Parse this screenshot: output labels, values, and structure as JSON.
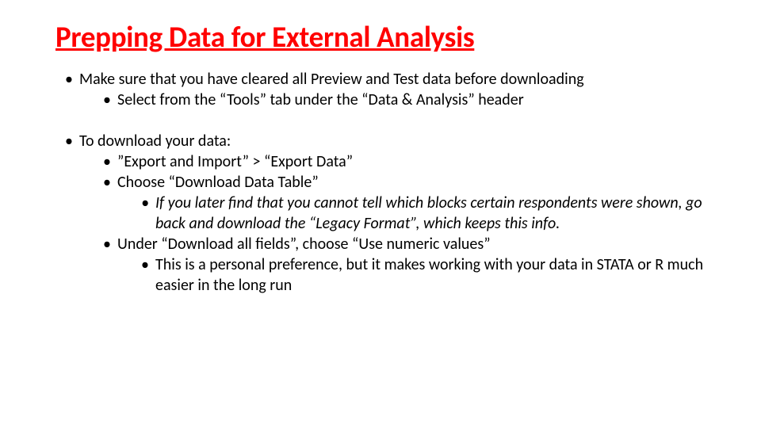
{
  "title": "Prepping Data for External Analysis",
  "bullets": {
    "a1": "Make sure that you have cleared all Preview and Test data before downloading",
    "a1_1": "Select from the “Tools” tab under the “Data & Analysis” header",
    "b1": "To download your data:",
    "b1_1": "”Export and Import” > “Export Data”",
    "b1_2": "Choose “Download Data Table”",
    "b1_2_1": "If you later find that you cannot tell which blocks certain respondents were shown, go back and download the “Legacy Format”, which keeps this info.",
    "b1_3": "Under “Download all fields”, choose “Use numeric values”",
    "b1_3_1": "This is a personal preference, but it makes working with your data in STATA or R much easier in the long run"
  }
}
